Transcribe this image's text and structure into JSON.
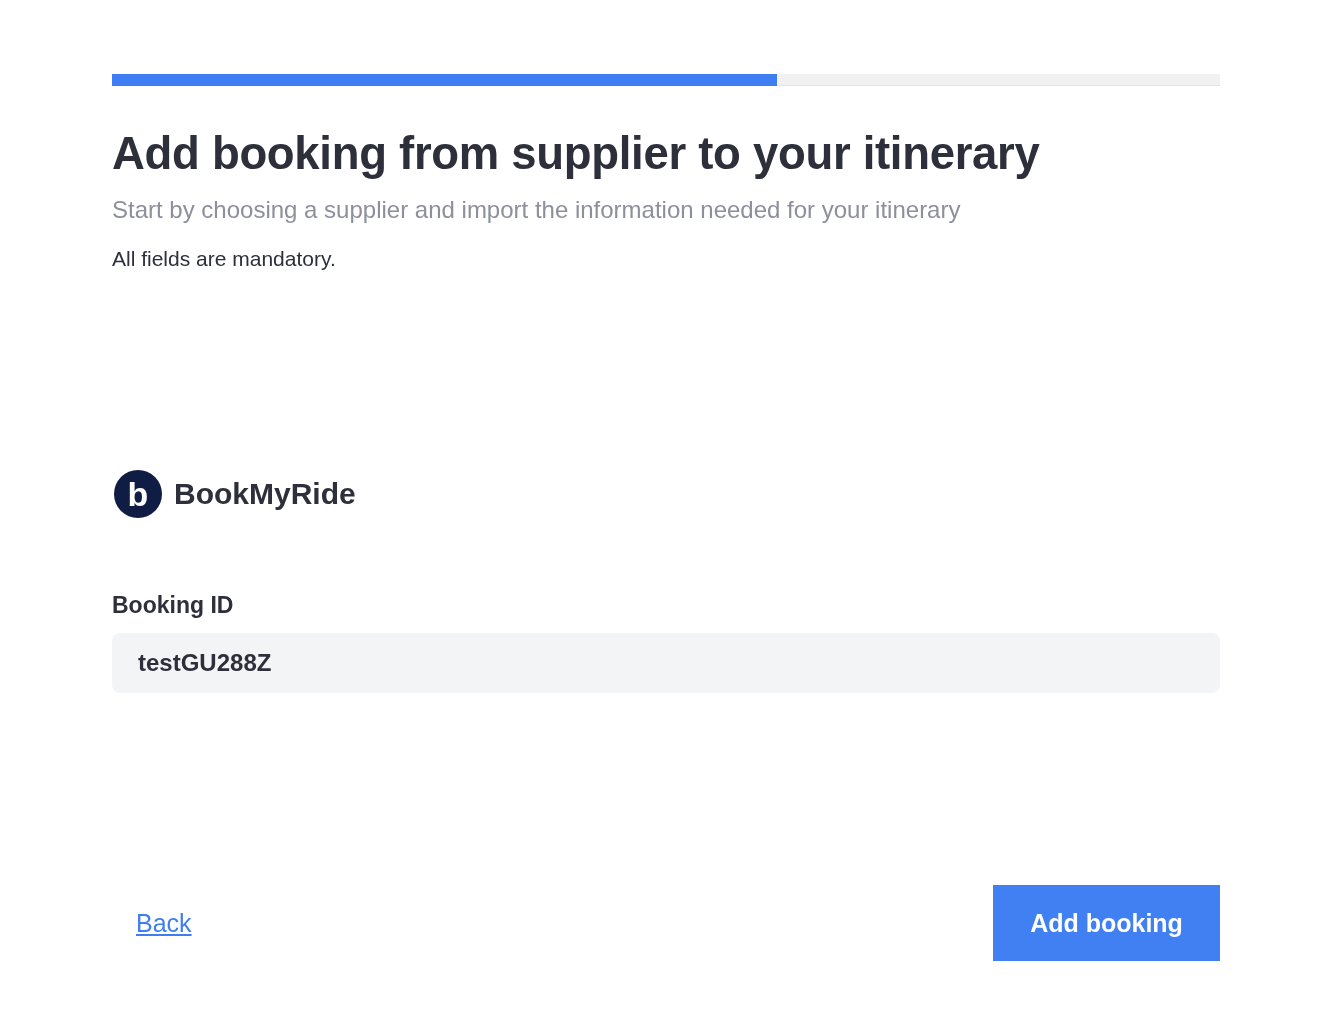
{
  "progress": {
    "level": 0.6
  },
  "title": "Add booking from supplier to your itinerary",
  "subtitle": "Start by choosing a supplier and import the information needed for your itinerary",
  "note": "All fields are mandatory.",
  "supplier": {
    "logo_letter": "b",
    "name": "BookMyRide"
  },
  "field": {
    "label": "Booking ID",
    "value": "testGU288Z"
  },
  "back_link": "Back",
  "submit_button": "Add booking"
}
